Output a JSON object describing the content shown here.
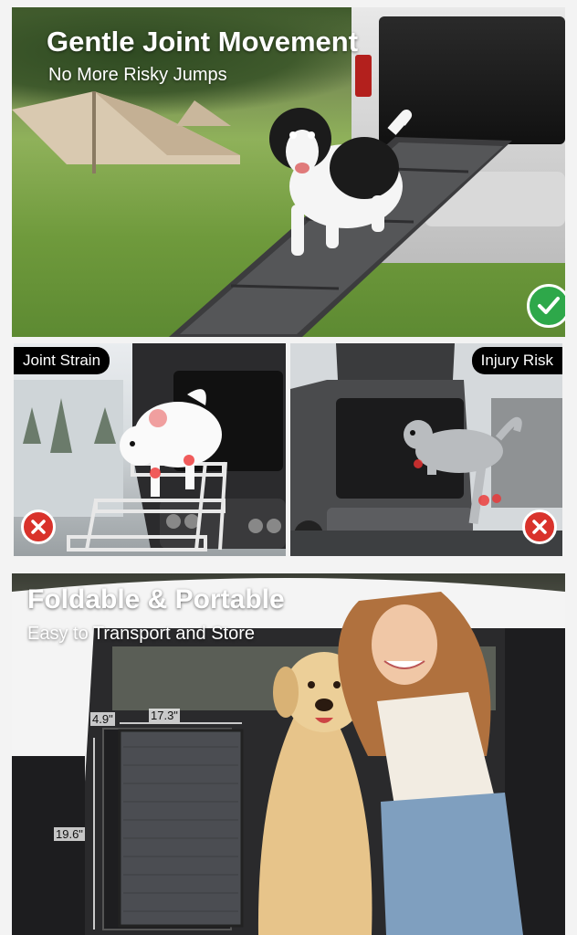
{
  "hero": {
    "title": "Gentle Joint Movement",
    "subtitle": "No More Risky Jumps",
    "badge_icon": "checkmark-icon",
    "badge_color": "#2ea84a"
  },
  "comparisons": [
    {
      "label": "Joint Strain",
      "badge_icon": "cross-icon",
      "badge_color": "#d9322b"
    },
    {
      "label": "Injury Risk",
      "badge_icon": "cross-icon",
      "badge_color": "#d9322b"
    }
  ],
  "portable": {
    "title": "Foldable & Portable",
    "subtitle": "Easy to Transport and Store",
    "dimensions": {
      "depth": "4.9\"",
      "width": "17.3\"",
      "height": "19.6\""
    }
  }
}
